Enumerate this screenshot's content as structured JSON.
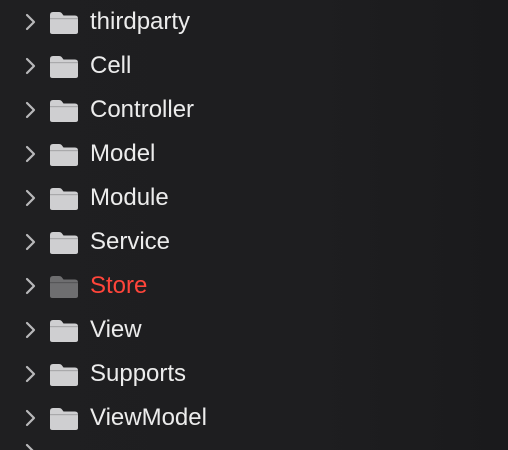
{
  "navigator": {
    "items": [
      {
        "label": "thirdparty",
        "icon": "folder-icon",
        "expanded": false,
        "status": "normal"
      },
      {
        "label": "Cell",
        "icon": "folder-icon",
        "expanded": false,
        "status": "normal"
      },
      {
        "label": "Controller",
        "icon": "folder-icon",
        "expanded": false,
        "status": "normal"
      },
      {
        "label": "Model",
        "icon": "folder-icon",
        "expanded": false,
        "status": "normal"
      },
      {
        "label": "Module",
        "icon": "folder-icon",
        "expanded": false,
        "status": "normal"
      },
      {
        "label": "Service",
        "icon": "folder-icon",
        "expanded": false,
        "status": "normal"
      },
      {
        "label": "Store",
        "icon": "folder-icon",
        "expanded": false,
        "status": "error"
      },
      {
        "label": "View",
        "icon": "folder-icon",
        "expanded": false,
        "status": "normal"
      },
      {
        "label": "Supports",
        "icon": "folder-icon",
        "expanded": false,
        "status": "normal"
      },
      {
        "label": "ViewModel",
        "icon": "folder-icon",
        "expanded": false,
        "status": "normal"
      }
    ]
  },
  "colors": {
    "background": "#1e1e20",
    "text": "#ececec",
    "error_text": "#ff453a",
    "folder": "#cfcfd1",
    "folder_dimmed": "#6e6e70",
    "chevron": "#b8b8ba"
  }
}
